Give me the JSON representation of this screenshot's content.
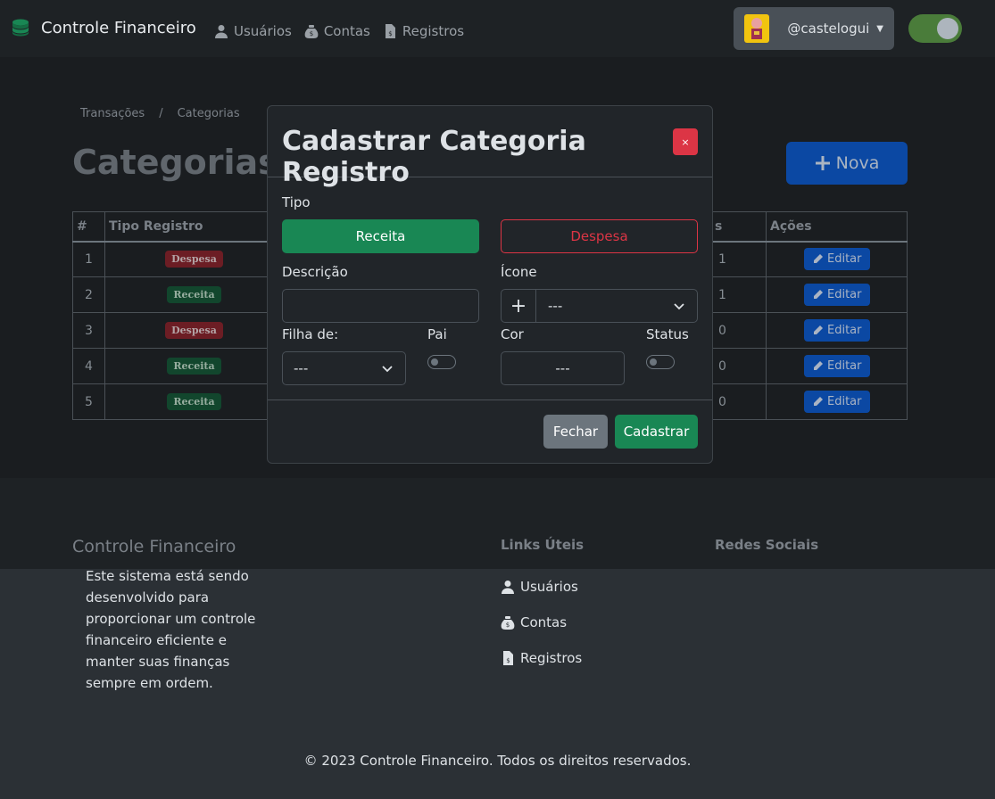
{
  "navbar": {
    "brand": "Controle Financeiro",
    "links": [
      {
        "label": "Usuários",
        "icon": "user-icon"
      },
      {
        "label": "Contas",
        "icon": "money-bag-icon"
      },
      {
        "label": "Registros",
        "icon": "invoice-icon"
      }
    ],
    "username": "@castelogui"
  },
  "page": {
    "breadcrumb": [
      "Transações",
      "Categorias"
    ],
    "title": "Categorias d",
    "new_button": "Nova",
    "table": {
      "headers": [
        "#",
        "Tipo Registro",
        "s",
        "Ações"
      ],
      "rows": [
        {
          "num": "1",
          "tipo": "Despesa",
          "qtd": "1",
          "action": "Editar"
        },
        {
          "num": "2",
          "tipo": "Receita",
          "qtd": "1",
          "action": "Editar"
        },
        {
          "num": "3",
          "tipo": "Despesa",
          "qtd": "0",
          "action": "Editar"
        },
        {
          "num": "4",
          "tipo": "Receita",
          "qtd": "0",
          "action": "Editar"
        },
        {
          "num": "5",
          "tipo": "Receita",
          "qtd": "0",
          "action": "Editar"
        }
      ]
    }
  },
  "modal": {
    "title": "Cadastrar Categoria Registro",
    "close_label": "×",
    "tipo_label": "Tipo",
    "receita_label": "Receita",
    "despesa_label": "Despesa",
    "descricao_label": "Descrição",
    "descricao_value": "",
    "icone_label": "Ícone",
    "icone_plus": "+",
    "icone_value": "---",
    "filha_label": "Filha de:",
    "filha_value": "---",
    "pai_label": "Pai",
    "cor_label": "Cor",
    "cor_value": "---",
    "status_label": "Status",
    "fechar_label": "Fechar",
    "cadastrar_label": "Cadastrar"
  },
  "footer": {
    "title": "Controle Financeiro",
    "description": "Este sistema está sendo desenvolvido para proporcionar um controle financeiro eficiente e manter suas finanças sempre em ordem.",
    "links_heading": "Links Úteis",
    "social_heading": "Redes Sociais",
    "links": [
      {
        "label": "Usuários",
        "icon": "user-icon"
      },
      {
        "label": "Contas",
        "icon": "money-bag-icon"
      },
      {
        "label": "Registros",
        "icon": "invoice-icon"
      }
    ],
    "copyright": "© 2023 Controle Financeiro. Todos os direitos reservados."
  },
  "colors": {
    "success": "#198754",
    "danger": "#dc3545",
    "primary": "#0d6efd",
    "secondary": "#6c757d"
  }
}
